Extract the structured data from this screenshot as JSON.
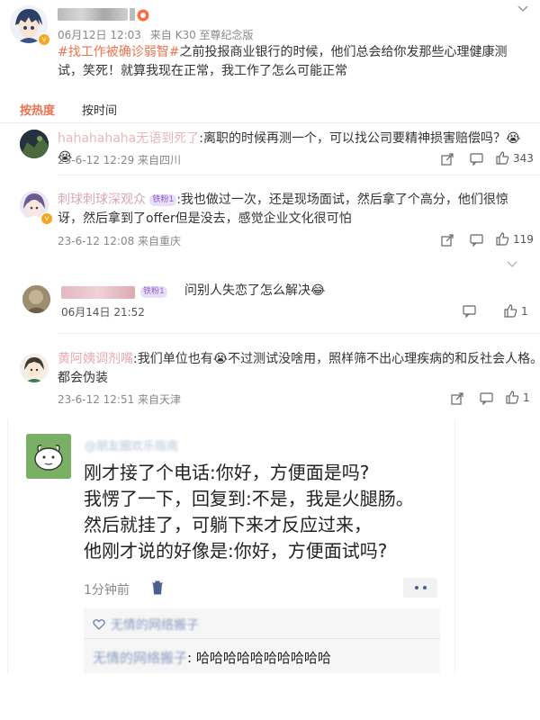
{
  "post": {
    "username": "",
    "date": "06月12日 12:03",
    "source": "来自 K30 至尊纪念版",
    "topic1": "#找工作被确诊弱智#",
    "text": "之前投报商业银行的时候，他们总会给你发那些心理健康测试，笑死！就算我现在正常，我工作了怎么可能正常"
  },
  "sort": {
    "hot": "按热度",
    "time": "按时间"
  },
  "comments": [
    {
      "name": "hahahahaha无语到死了",
      "text": ":离职的时候再测一个，可以找公司要精神损害赔偿吗？😭😭",
      "meta": "23-6-12 12:29 来自四川",
      "likes": "343"
    },
    {
      "name": "刺球刺球深观众",
      "badge": "铁粉1",
      "text": ":我也做过一次，还是现场面试，然后拿了个高分，他们很惊讶，然后拿到了offer但是没去，感觉企业文化很可怕",
      "meta": "23-6-12 12:08 来自重庆",
      "likes": "119"
    },
    {
      "name": "",
      "badge": "铁粉1",
      "text": "问别人失恋了怎么解决😂",
      "meta": "06月14日 21:52",
      "likes": "1"
    },
    {
      "name": "黄阿姨调剂嘴",
      "text": ":我们单位也有😭不过测试没啥用，照样筛不出心理疾病的和反社会人格。都会伪装",
      "meta": "23-6-12 12:51 来自天津",
      "likes": "1"
    }
  ],
  "card": {
    "username": "@朋友圈欢乐指南",
    "lines": [
      "刚才接了个电话:你好，方便面是吗?",
      "我愣了一下，回复到:不是，我是火腿肠。",
      "然后就挂了，可躺下来才反应过来，",
      "他刚才说的好像是:你好，方便面试吗?"
    ],
    "time": "1分钟前",
    "like_name": "无情的网络搬子",
    "reply_name": "无情的网络搬子",
    "reply_text": ": 哈哈哈哈哈哈哈哈哈哈"
  },
  "colors": {
    "accent": "#eb7350",
    "blur": "#d9a7ae",
    "link": "#5a6d96"
  }
}
